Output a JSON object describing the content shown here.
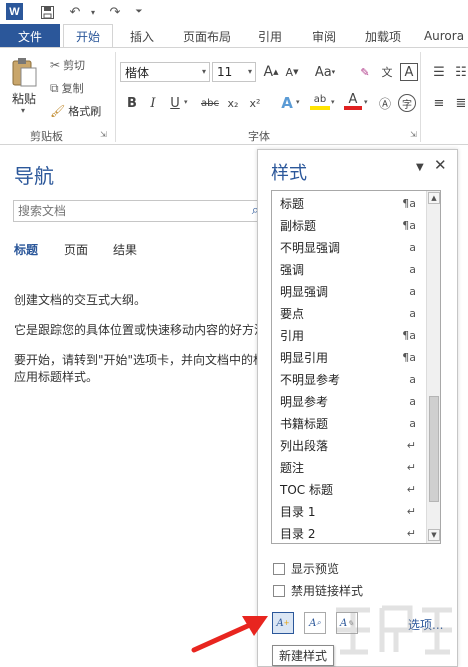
{
  "quick_access": {
    "undo": "↶",
    "redo": "↷"
  },
  "tabs": {
    "file": "文件",
    "home": "开始",
    "insert": "插入",
    "layout": "页面布局",
    "references": "引用",
    "review": "审阅",
    "addins": "加载项",
    "aurora": "Aurora"
  },
  "ribbon": {
    "paste": "粘贴",
    "cut": "剪切",
    "copy": "复制",
    "format_painter": "格式刷",
    "clipboard_group": "剪贴板",
    "font_name": "楷体",
    "font_size": "11",
    "font_group": "字体",
    "bold": "B",
    "italic": "I",
    "underline": "U",
    "strike": "abc",
    "subscript": "x₂",
    "superscript": "x²",
    "grow_font": "A",
    "shrink_font": "A",
    "change_case": "Aa",
    "char_border": "A",
    "text_effect": "A",
    "highlight": "ab",
    "font_color": "A",
    "enclose": "字"
  },
  "nav": {
    "title": "导航",
    "search_placeholder": "搜索文档",
    "tabs": [
      "标题",
      "页面",
      "结果"
    ],
    "lines": [
      "创建文档的交互式大纲。",
      "它是跟踪您的具体位置或快速移动内容的好方法",
      "要开始，请转到\"开始\"选项卡，并向文档中的标",
      "应用标题样式。"
    ]
  },
  "styles_pane": {
    "title": "样式",
    "menu": "▼",
    "close": "✕",
    "items": [
      {
        "name": "标题",
        "mark": "¶a"
      },
      {
        "name": "副标题",
        "mark": "¶a"
      },
      {
        "name": "不明显强调",
        "mark": "a"
      },
      {
        "name": "强调",
        "mark": "a"
      },
      {
        "name": "明显强调",
        "mark": "a"
      },
      {
        "name": "要点",
        "mark": "a"
      },
      {
        "name": "引用",
        "mark": "¶a"
      },
      {
        "name": "明显引用",
        "mark": "¶a"
      },
      {
        "name": "不明显参考",
        "mark": "a"
      },
      {
        "name": "明显参考",
        "mark": "a"
      },
      {
        "name": "书籍标题",
        "mark": "a"
      },
      {
        "name": "列出段落",
        "mark": "↵"
      },
      {
        "name": "题注",
        "mark": "↵"
      },
      {
        "name": "TOC 标题",
        "mark": "↵"
      },
      {
        "name": "目录 1",
        "mark": "↵"
      },
      {
        "name": "目录 2",
        "mark": "↵"
      }
    ],
    "show_preview": "显示预览",
    "disable_linked": "禁用链接样式",
    "new_style_glyph": "A",
    "inspector_glyph": "A",
    "manage_glyph": "A",
    "options": "选项...",
    "tooltip": "新建样式"
  },
  "colors": {
    "accent": "#2b579a",
    "arrow": "#e8251f"
  }
}
